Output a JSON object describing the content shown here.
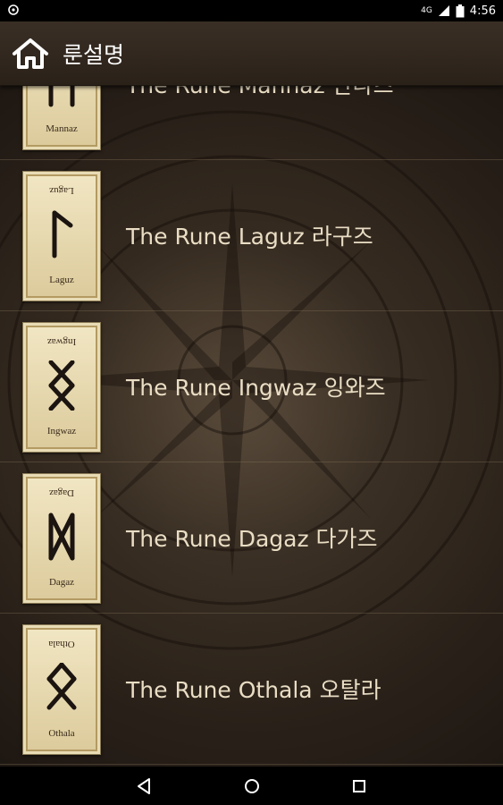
{
  "status_bar": {
    "time": "4:56",
    "network": "4G"
  },
  "app_bar": {
    "title": "룬설명",
    "home_icon": "home-icon"
  },
  "runes": [
    {
      "label": "The Rune Mannaz 만나즈",
      "card_name": "Mannaz",
      "glyph": "mannaz"
    },
    {
      "label": "The Rune Laguz 라구즈",
      "card_name": "Laguz",
      "glyph": "laguz"
    },
    {
      "label": "The Rune Ingwaz 잉와즈",
      "card_name": "Ingwaz",
      "glyph": "ingwaz"
    },
    {
      "label": "The Rune Dagaz 다가즈",
      "card_name": "Dagaz",
      "glyph": "dagaz"
    },
    {
      "label": "The Rune Othala 오탈라",
      "card_name": "Othala",
      "glyph": "othala"
    }
  ],
  "nav_bar": {
    "back_icon": "back-triangle-icon",
    "home_icon": "home-circle-icon",
    "recents_icon": "recents-square-icon"
  },
  "colors": {
    "label_text": "#e9ddc4",
    "card_paper": "#e8dcb5",
    "app_bar": "#3a2f25"
  }
}
